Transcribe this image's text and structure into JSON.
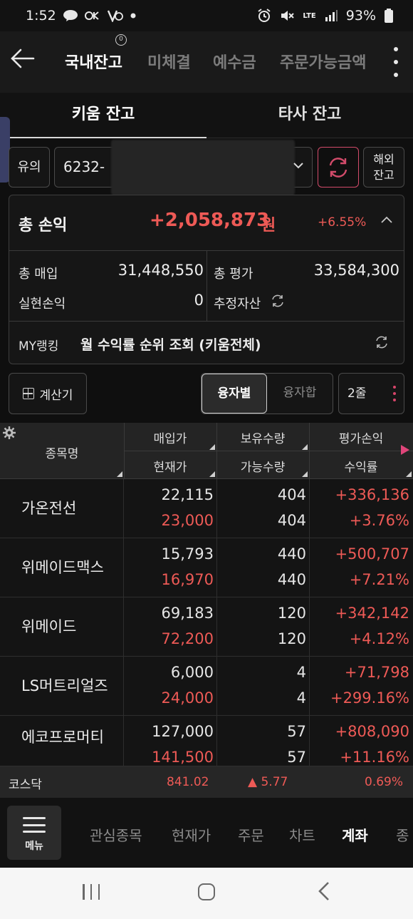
{
  "status_bar": {
    "time": "1:52",
    "battery": "93%",
    "network": "LTE"
  },
  "header": {
    "tabs": [
      "국내잔고",
      "미체결",
      "예수금",
      "주문가능금액"
    ],
    "active_tab": 0
  },
  "subtabs": [
    "키움 잔고",
    "타사 잔고"
  ],
  "account": {
    "caution_label": "유의",
    "account_prefix": "6232-",
    "overseas_label_1": "해외",
    "overseas_label_2": "잔고"
  },
  "summary": {
    "total_pl_label": "총 손익",
    "total_pl_value": "+2,058,873",
    "total_pl_unit": "원",
    "total_pl_rate": "+6.55%",
    "total_buy_label": "총 매입",
    "total_buy_value": "31,448,550",
    "total_eval_label": "총 평가",
    "total_eval_value": "33,584,300",
    "realized_label": "실현손익",
    "realized_value": "0",
    "estimated_label": "추정자산",
    "ranking_label": "MY랭킹",
    "ranking_text": "월 수익률 순위 조회 (키움전체)"
  },
  "controls": {
    "calculator_label": "계산기",
    "segments": [
      "융자별",
      "융자합"
    ],
    "rows_label": "2줄"
  },
  "table": {
    "headers": {
      "name": "종목명",
      "buy_price": "매입가",
      "current_price": "현재가",
      "holding_qty": "보유수량",
      "available_qty": "가능수량",
      "eval_pl": "평가손익",
      "return_rate": "수익률"
    },
    "rows": [
      {
        "name": "가온전선",
        "buy_price": "22,115",
        "current_price": "23,000",
        "holding_qty": "404",
        "available_qty": "404",
        "eval_pl": "+336,136",
        "return_rate": "+3.76%"
      },
      {
        "name": "위메이드맥스",
        "buy_price": "15,793",
        "current_price": "16,970",
        "holding_qty": "440",
        "available_qty": "440",
        "eval_pl": "+500,707",
        "return_rate": "+7.21%"
      },
      {
        "name": "위메이드",
        "buy_price": "69,183",
        "current_price": "72,200",
        "holding_qty": "120",
        "available_qty": "120",
        "eval_pl": "+342,142",
        "return_rate": "+4.12%"
      },
      {
        "name": "LS머트리얼즈",
        "buy_price": "6,000",
        "current_price": "24,000",
        "holding_qty": "4",
        "available_qty": "4",
        "eval_pl": "+71,798",
        "return_rate": "+299.16%"
      },
      {
        "name": "에코프로머티",
        "buy_price": "127,000",
        "current_price": "141,500",
        "holding_qty": "57",
        "available_qty": "57",
        "eval_pl": "+808,090",
        "return_rate": "+11.16%"
      }
    ]
  },
  "ticker": {
    "name": "코스닥",
    "value": "841.02",
    "change": "▲ 5.77",
    "rate": "0.69%"
  },
  "bottom_nav": {
    "menu_label": "메뉴",
    "items": [
      "관심종목",
      "현재가",
      "주문",
      "차트",
      "계좌",
      "종"
    ],
    "active_item": 4
  },
  "colors": {
    "up": "#ee5a56",
    "accent": "#d8456a",
    "background": "#0f0f0f"
  }
}
